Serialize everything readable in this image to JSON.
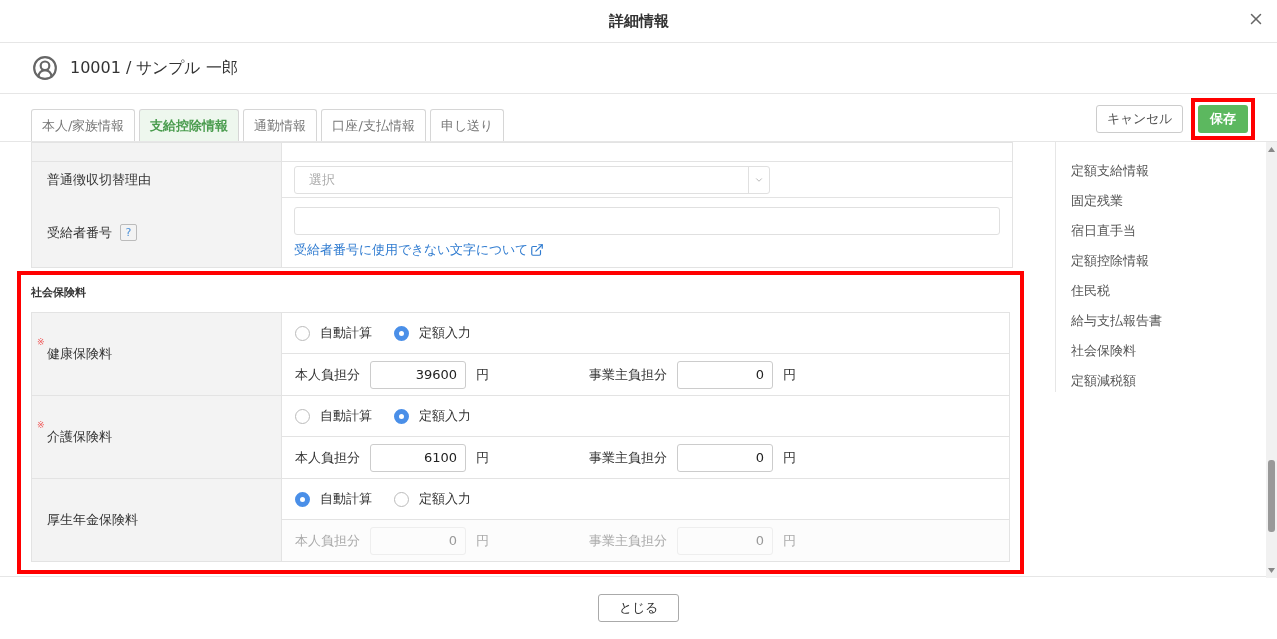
{
  "dialog": {
    "title": "詳細情報"
  },
  "employee": {
    "label": "10001 / サンプル 一郎"
  },
  "tabs": [
    {
      "label": "本人/家族情報",
      "selected": false
    },
    {
      "label": "支給控除情報",
      "selected": true
    },
    {
      "label": "通勤情報",
      "selected": false
    },
    {
      "label": "口座/支払情報",
      "selected": false
    },
    {
      "label": "申し送り",
      "selected": false
    }
  ],
  "actions": {
    "cancel": "キャンセル",
    "save": "保存",
    "save_highlighted": true
  },
  "form_rows": [
    {
      "kind": "select",
      "label": "普通徴収切替理由",
      "placeholder": "選択"
    },
    {
      "kind": "text",
      "label": "受給者番号",
      "help": "?",
      "link": "受給者番号に使用できない文字について"
    }
  ],
  "social_insurance": {
    "title": "社会保険料",
    "highlighted": true,
    "rows": [
      {
        "label": "健康保険料",
        "required_mark": "※",
        "disabled": false,
        "options": [
          {
            "label": "自動計算",
            "selected": false
          },
          {
            "label": "定額入力",
            "selected": true
          }
        ],
        "employee_label": "本人負担分",
        "employee_value": "39600",
        "employee_unit": "円",
        "employer_label": "事業主負担分",
        "employer_value": "0",
        "employer_unit": "円"
      },
      {
        "label": "介護保険料",
        "required_mark": "※",
        "disabled": false,
        "options": [
          {
            "label": "自動計算",
            "selected": false
          },
          {
            "label": "定額入力",
            "selected": true
          }
        ],
        "employee_label": "本人負担分",
        "employee_value": "6100",
        "employee_unit": "円",
        "employer_label": "事業主負担分",
        "employer_value": "0",
        "employer_unit": "円"
      },
      {
        "label": "厚生年金保険料",
        "disabled": true,
        "options": [
          {
            "label": "自動計算",
            "selected": true
          },
          {
            "label": "定額入力",
            "selected": false
          }
        ],
        "employee_label": "本人負担分",
        "employee_value": "0",
        "employee_unit": "円",
        "employer_label": "事業主負担分",
        "employer_value": "0",
        "employer_unit": "円"
      }
    ]
  },
  "side_nav": [
    "定額支給情報",
    "固定残業",
    "宿日直手当",
    "定額控除情報",
    "住民税",
    "給与支払報告書",
    "社会保険料",
    "定額減税額"
  ],
  "footer": {
    "close": "とじる"
  }
}
